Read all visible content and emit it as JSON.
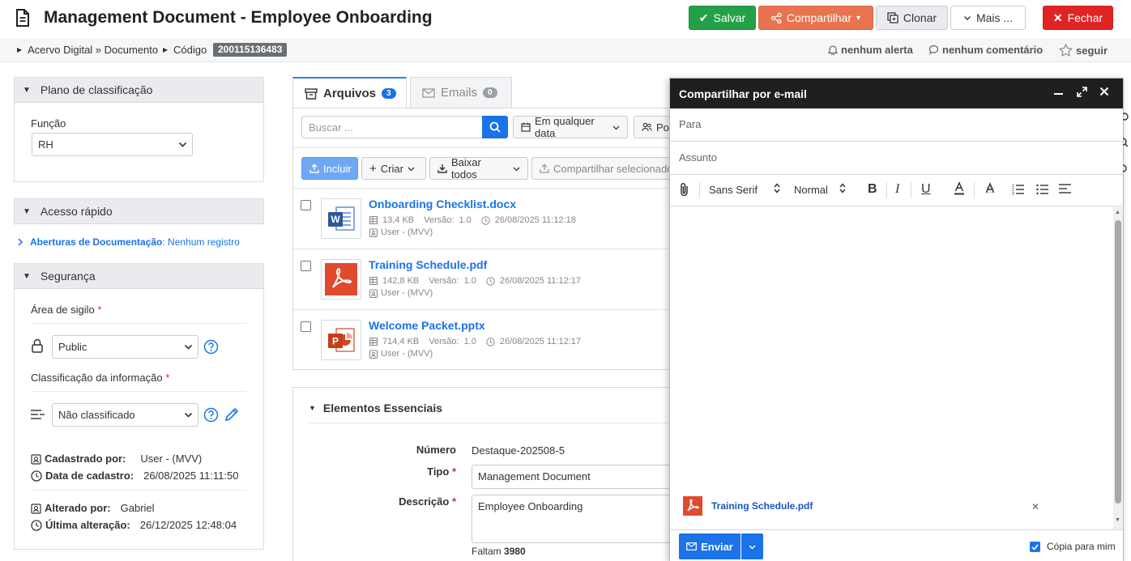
{
  "header": {
    "title": "Management Document - Employee Onboarding",
    "save_label": "Salvar",
    "share_label": "Compartilhar",
    "clone_label": "Clonar",
    "more_label": "Mais ...",
    "close_label": "Fechar"
  },
  "breadcrumb": {
    "path": "Acervo Digital » Documento",
    "code_label": "Código",
    "code_value": "200115136483",
    "alerts": "nenhum alerta",
    "comments": "nenhum comentário",
    "follow": "seguir"
  },
  "classification": {
    "title": "Plano de classificação",
    "function_label": "Função",
    "function_value": "RH"
  },
  "quick_access": {
    "title": "Acesso rápido",
    "link": "Aberturas de Documentação",
    "link_value": ": Nenhum registro"
  },
  "security": {
    "title": "Segurança",
    "secrecy_label": "Área de sigilo",
    "secrecy_value": "Public",
    "info_class_label": "Classificação da informação",
    "info_class_value": "Não classificado",
    "created_by_label": "Cadastrado por:",
    "created_by_value": "User - (MVV)",
    "created_date_label": "Data de cadastro:",
    "created_date_value": "26/08/2025 11:11:50",
    "changed_by_label": "Alterado por:",
    "changed_by_value": "Gabriel",
    "changed_date_label": "Última alteração:",
    "changed_date_value": "26/12/2025 12:48:04"
  },
  "tabs": {
    "files_label": "Arquivos",
    "files_count": "3",
    "emails_label": "Emails",
    "emails_count": "0"
  },
  "files_toolbar": {
    "search_placeholder": "Buscar ...",
    "date_filter": "Em qualquer data",
    "person_filter": "Por",
    "include": "Incluir",
    "create": "Criar",
    "download_all": "Baixar todos",
    "share_selected": "Compartilhar selecionados"
  },
  "files": [
    {
      "name": "Onboarding Checklist.docx",
      "size": "13,4 KB",
      "version_label": "Versão:",
      "version": "1.0",
      "date": "26/08/2025 11:12:18",
      "user": "User - (MVV)",
      "type": "word"
    },
    {
      "name": "Training Schedule.pdf",
      "size": "142,8 KB",
      "version_label": "Versão:",
      "version": "1.0",
      "date": "26/08/2025 11:12:17",
      "user": "User - (MVV)",
      "type": "pdf"
    },
    {
      "name": "Welcome Packet.pptx",
      "size": "714,4 KB",
      "version_label": "Versão:",
      "version": "1.0",
      "date": "26/08/2025 11:12:17",
      "user": "User - (MVV)",
      "type": "ppt"
    }
  ],
  "essentials": {
    "title": "Elementos Essenciais",
    "number_label": "Número",
    "number_value": "Destaque-202508-5",
    "type_label": "Tipo",
    "type_value": "Management Document",
    "desc_label": "Descrição",
    "desc_value": "Employee Onboarding",
    "remaining_label": "Faltam",
    "remaining_value": "3980"
  },
  "dialog": {
    "title": "Compartilhar por e-mail",
    "to_placeholder": "Para",
    "subject_placeholder": "Assunto",
    "font_family": "Sans Serif",
    "font_size": "Normal",
    "attachment_name": "Training Schedule.pdf",
    "send_label": "Enviar",
    "copy_label": "Cópia para mim"
  },
  "colors": {
    "save": "#24a148",
    "share": "#e8744f",
    "close": "#e02424",
    "link": "#1a73e8"
  }
}
